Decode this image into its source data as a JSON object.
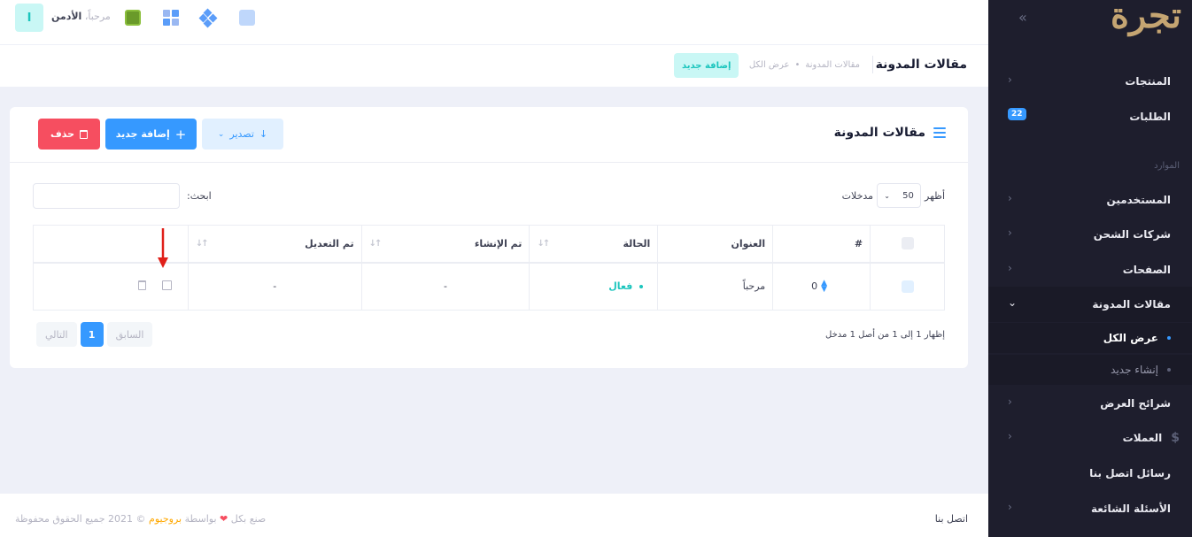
{
  "sidebar": {
    "logo": "تجرة",
    "section_label": "الموارد",
    "items": [
      {
        "label": "المنتجات",
        "icon": "products-icon"
      },
      {
        "label": "الطلبات",
        "icon": "orders-icon",
        "badge": "22"
      },
      {
        "label": "المستخدمين",
        "icon": "users-icon"
      },
      {
        "label": "شركات الشحن",
        "icon": "shipping-icon"
      },
      {
        "label": "الصفحات",
        "icon": "pages-icon"
      },
      {
        "label": "مقالات المدونة",
        "icon": "blog-icon"
      },
      {
        "label": "شرائح العرض",
        "icon": "slides-icon"
      },
      {
        "label": "العملات",
        "icon": "currency-icon"
      },
      {
        "label": "رسائل اتصل بنا",
        "icon": "messages-icon"
      },
      {
        "label": "الأسئلة الشائعة",
        "icon": "faq-icon"
      }
    ],
    "subitems": [
      {
        "label": "عرض الكل"
      },
      {
        "label": "إنشاء جديد"
      }
    ]
  },
  "topbar": {
    "avatar_letter": "I",
    "greeting_prefix": "مرحباً،",
    "greeting_name": "الأدمن"
  },
  "subheader": {
    "title": "مقالات المدونة",
    "breadcrumb": [
      "مقالات المدونة",
      "عرض الكل"
    ],
    "add_label": "إضافة جديد"
  },
  "card": {
    "title": "مقالات المدونة",
    "export_label": "تصدير",
    "add_label": "إضافة جديد",
    "delete_label": "حذف",
    "length_prefix": "أظهر",
    "length_value": "50",
    "length_suffix": "مدخلات",
    "search_label": "ابحث:",
    "search_value": "",
    "columns": [
      "#",
      "العنوان",
      "الحالة",
      "تم الإنشاء",
      "تم التعديل"
    ],
    "rows": [
      {
        "id": "0",
        "title": "مرحباً",
        "status": "فعال",
        "created": "-",
        "updated": "-"
      }
    ],
    "info": "إظهار 1 إلى 1 من أصل 1 مدخل",
    "pagination": {
      "prev": "السابق",
      "current": "1",
      "next": "التالي"
    }
  },
  "footer": {
    "made_with": "صنع بكل",
    "by": "بواسطة",
    "brand": "بروجيوم",
    "copyright": "© 2021 جميع الحقوق محفوظة",
    "contact": "اتصل بنا"
  },
  "colors": {
    "primary": "#3699ff",
    "success": "#1bc5bd",
    "danger": "#f64e60",
    "sidebar": "#1e1e2d"
  }
}
